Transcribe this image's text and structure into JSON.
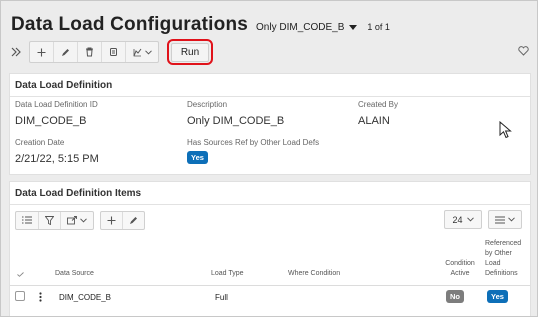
{
  "header": {
    "title": "Data Load Configurations",
    "view_name": "Only DIM_CODE_B",
    "record_count": "1 of 1"
  },
  "toolbar": {
    "run_label": "Run",
    "icons": [
      "expand-icon",
      "add-icon",
      "edit-icon",
      "delete-icon",
      "copy-icon",
      "actions-icon",
      "chevron-down-icon"
    ]
  },
  "definition": {
    "title": "Data Load Definition",
    "fields": {
      "id_label": "Data Load Definition ID",
      "id_value": "DIM_CODE_B",
      "description_label": "Description",
      "description_value": "Only DIM_CODE_B",
      "created_by_label": "Created By",
      "created_by_value": "ALAIN",
      "creation_date_label": "Creation Date",
      "creation_date_value": "2/21/22, 5:15 PM",
      "sources_label": "Has Sources Ref by Other Load Defs",
      "sources_value": "Yes"
    }
  },
  "items": {
    "title": "Data Load Definition Items",
    "page_size": "24",
    "columns": {
      "data_source": "Data Source",
      "load_type": "Load Type",
      "where_condition": "Where Condition",
      "condition_active_1": "Condition",
      "condition_active_2": "Active",
      "referenced_1": "Referenced",
      "referenced_2": "by Other",
      "referenced_3": "Load",
      "referenced_4": "Definitions"
    },
    "rows": [
      {
        "data_source": "DIM_CODE_B",
        "load_type": "Full",
        "where_condition": "",
        "condition_active": "No",
        "referenced": "Yes"
      }
    ]
  },
  "colors": {
    "badge_blue": "#0d6fb8",
    "badge_gray": "#7d7d7d",
    "highlight_red": "#e0121a",
    "background": "#ececec"
  }
}
